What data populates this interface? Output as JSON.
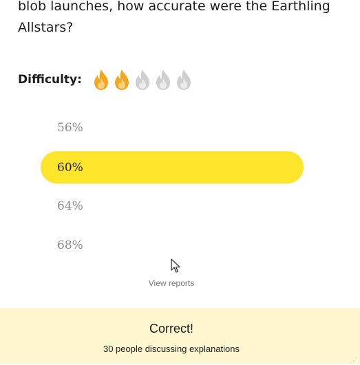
{
  "question": {
    "text": "blob launches, how accurate were the Earthling Allstars?"
  },
  "difficulty": {
    "label": "Difficulty:",
    "level": 2,
    "max": 5,
    "active_color": "#f0a824",
    "inactive_color": "#cfcfcf"
  },
  "options": [
    {
      "label": "56%",
      "selected": false
    },
    {
      "label": "60%",
      "selected": true
    },
    {
      "label": "64%",
      "selected": false
    },
    {
      "label": "68%",
      "selected": false
    }
  ],
  "highlight_color": "#fde52b",
  "view_reports_label": "View reports",
  "result": {
    "title": "Correct!",
    "subtitle": "30 people discussing explanations",
    "background": "#fdf6cf"
  }
}
